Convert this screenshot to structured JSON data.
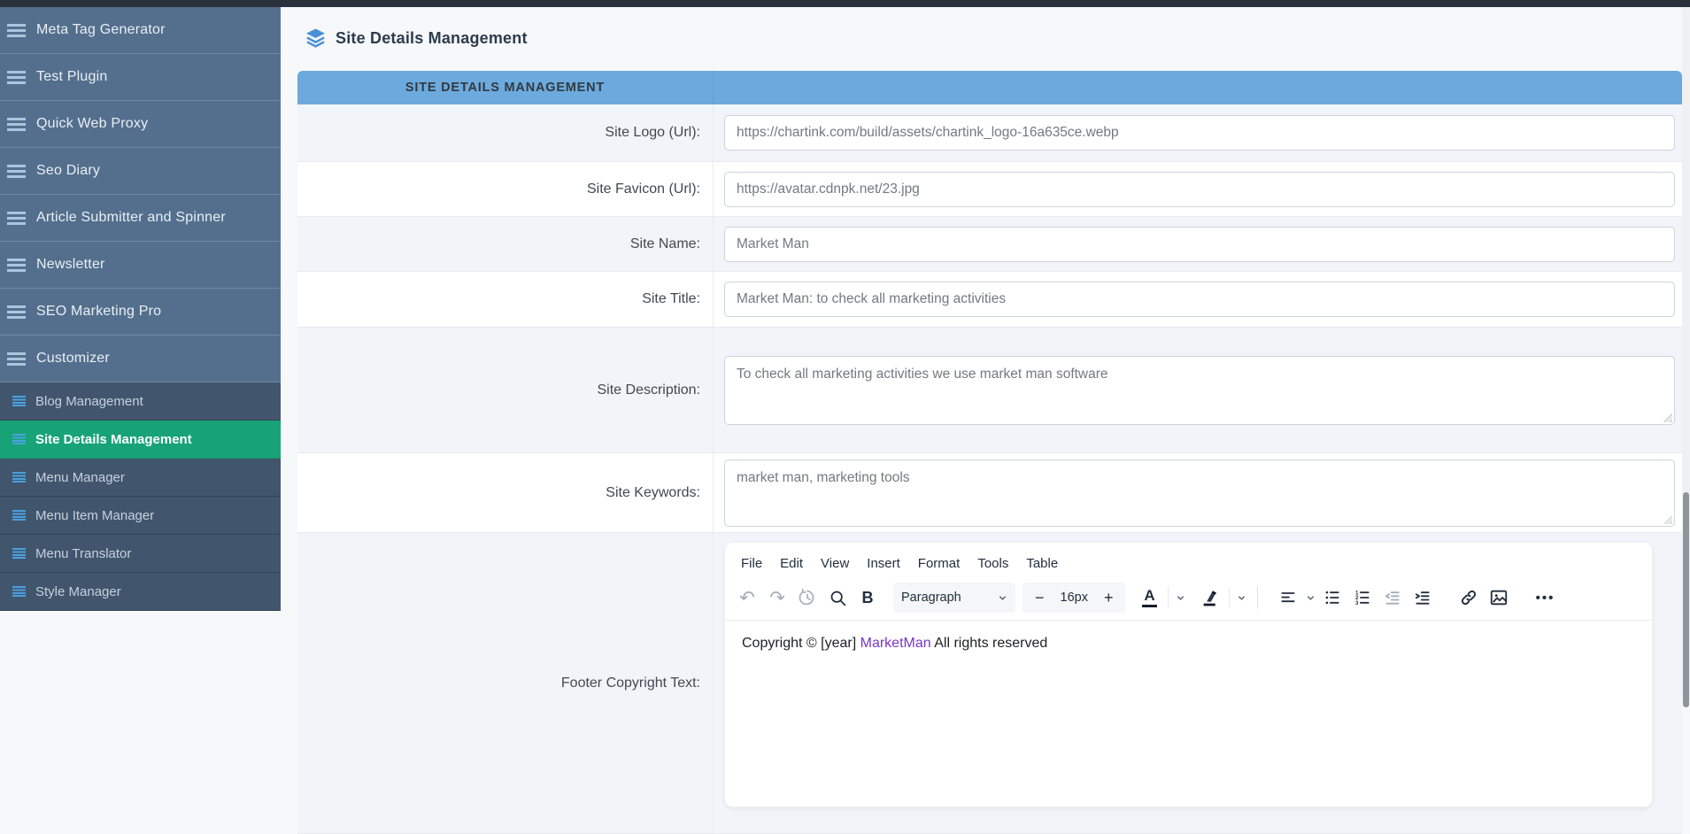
{
  "sidebar": {
    "items": [
      {
        "label": "Meta Tag Generator"
      },
      {
        "label": "Test Plugin"
      },
      {
        "label": "Quick Web Proxy"
      },
      {
        "label": "Seo Diary"
      },
      {
        "label": "Article Submitter and Spinner"
      },
      {
        "label": "Newsletter"
      },
      {
        "label": "SEO Marketing Pro"
      },
      {
        "label": "Customizer"
      }
    ],
    "subitems": [
      {
        "label": "Blog Management",
        "active": false
      },
      {
        "label": "Site Details Management",
        "active": true
      },
      {
        "label": "Menu Manager",
        "active": false
      },
      {
        "label": "Menu Item Manager",
        "active": false
      },
      {
        "label": "Menu Translator",
        "active": false
      },
      {
        "label": "Style Manager",
        "active": false
      }
    ]
  },
  "page": {
    "title": "Site Details Management"
  },
  "panel": {
    "header": "SITE DETAILS MANAGEMENT"
  },
  "form": {
    "rows": [
      {
        "label": "Site Logo (Url):",
        "value": "https://chartink.com/build/assets/chartink_logo-16a635ce.webp",
        "type": "input"
      },
      {
        "label": "Site Favicon (Url):",
        "value": "https://avatar.cdnpk.net/23.jpg",
        "type": "input"
      },
      {
        "label": "Site Name:",
        "value": "Market Man",
        "type": "input"
      },
      {
        "label": "Site Title:",
        "value": "Market Man: to check all marketing activities",
        "type": "input"
      },
      {
        "label": "Site Description:",
        "value": "To check all marketing activities we use market man software",
        "type": "textarea"
      },
      {
        "label": "Site Keywords:",
        "value": "market man, marketing tools",
        "type": "textarea"
      },
      {
        "label": "Footer Copyright Text:",
        "type": "editor"
      }
    ]
  },
  "editor": {
    "menu": [
      "File",
      "Edit",
      "View",
      "Insert",
      "Format",
      "Tools",
      "Table"
    ],
    "toolbar": {
      "undo": "↶",
      "redo": "↷",
      "bold": "B",
      "paragraph": "Paragraph",
      "decrease": "−",
      "font_size": "16px",
      "increase": "+",
      "color_letter": "A",
      "more": "•••"
    },
    "toolbar_icons": [
      "undo-icon",
      "redo-icon",
      "restore-draft-icon",
      "search-icon",
      "bold-button",
      "paragraph-dropdown",
      "decrease-fontsize-button",
      "fontsize-value",
      "increase-fontsize-button",
      "text-color-button",
      "highlight-color-button",
      "align-left-dropdown",
      "bullet-list-button",
      "numbered-list-button",
      "outdent-button",
      "indent-button",
      "link-button",
      "image-button",
      "more-button"
    ],
    "content": {
      "prefix": "Copyright © [year]  ",
      "link_text": "MarketMan",
      "suffix": " All rights reserved"
    }
  },
  "colors": {
    "topbar": "#2b313b",
    "sidebar_bg": "#546f8d",
    "sidebar_sub_bg": "#41556d",
    "active_green": "#17a376",
    "header_blue": "#6caade",
    "title_icon_blue": "#4b90d6",
    "sub_icon_blue": "#49a1df",
    "link_purple": "#7a36c8"
  }
}
